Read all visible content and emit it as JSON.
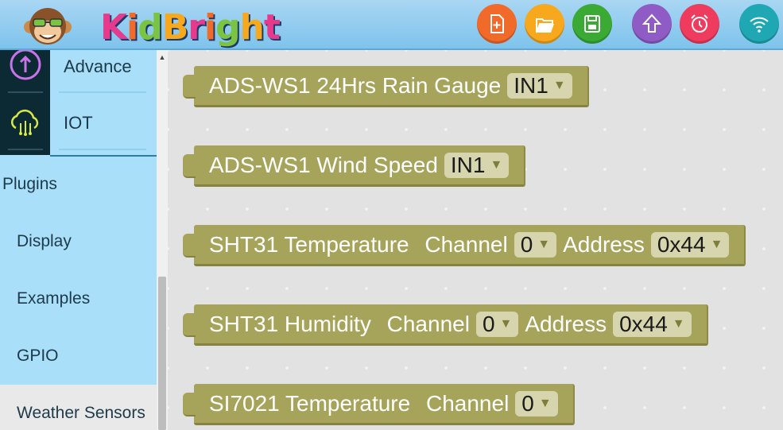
{
  "header": {
    "logo_text": "KidBright",
    "buttons": [
      {
        "name": "new-file",
        "color": "#f26a2a"
      },
      {
        "name": "open-file",
        "color": "#f7a81d"
      },
      {
        "name": "save-file",
        "color": "#3aaa35"
      },
      {
        "name": "upload",
        "color": "#8e5cc4"
      },
      {
        "name": "alarm",
        "color": "#ef3b5d"
      },
      {
        "name": "wifi",
        "color": "#1fa8b3"
      }
    ]
  },
  "sidebar": {
    "categories": [
      {
        "label": "Advance",
        "icon": "advance-icon"
      },
      {
        "label": "IOT",
        "icon": "iot-cloud-icon"
      }
    ],
    "plugins_title": "Plugins",
    "plugins": [
      {
        "label": "Display"
      },
      {
        "label": "Examples"
      },
      {
        "label": "GPIO"
      },
      {
        "label": "Weather Sensors",
        "selected": true
      }
    ]
  },
  "blocks": [
    {
      "text": "ADS-WS1 24Hrs Rain Gauge",
      "fields": [
        {
          "value": "IN1"
        }
      ]
    },
    {
      "text": "ADS-WS1 Wind Speed",
      "fields": [
        {
          "value": "IN1"
        }
      ]
    },
    {
      "text": "SHT31 Temperature ",
      "label2": "Channel",
      "label3": "Address",
      "fields": [
        {
          "value": "0"
        },
        {
          "value": "0x44"
        }
      ]
    },
    {
      "text": "SHT31 Humidity ",
      "label2": "Channel",
      "label3": "Address",
      "fields": [
        {
          "value": "0"
        },
        {
          "value": "0x44"
        }
      ]
    },
    {
      "text": "SI7021 Temperature ",
      "label2": "Channel",
      "fields": [
        {
          "value": "0"
        }
      ]
    }
  ],
  "colors": {
    "block": "#a6a45b",
    "field": "#d6d5ad",
    "sidebar": "#aadffa",
    "header": "#7ec3ec"
  }
}
